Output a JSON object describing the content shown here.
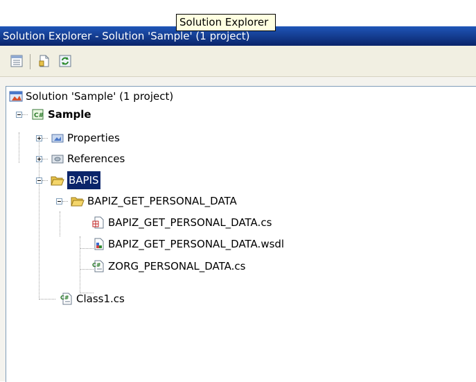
{
  "tooltip": "Solution Explorer",
  "window": {
    "title": "Solution Explorer - Solution 'Sample' (1 project)"
  },
  "toolbar": {
    "buttons": [
      "properties-icon",
      "show-all-files-icon",
      "refresh-icon"
    ]
  },
  "tree": {
    "solution": "Solution 'Sample' (1 project)",
    "project": "Sample",
    "properties": "Properties",
    "references": "References",
    "bapis": "BAPIS",
    "bapiz_folder": "BAPIZ_GET_PERSONAL_DATA",
    "file_cs": "BAPIZ_GET_PERSONAL_DATA.cs",
    "file_wsdl": "BAPIZ_GET_PERSONAL_DATA.wsdl",
    "file_zorg": "ZORG_PERSONAL_DATA.cs",
    "class1": "Class1.cs"
  },
  "colors": {
    "titlebar": "#0a246a",
    "selection": "#0a246a",
    "tooltip_bg": "#ffffe1"
  }
}
